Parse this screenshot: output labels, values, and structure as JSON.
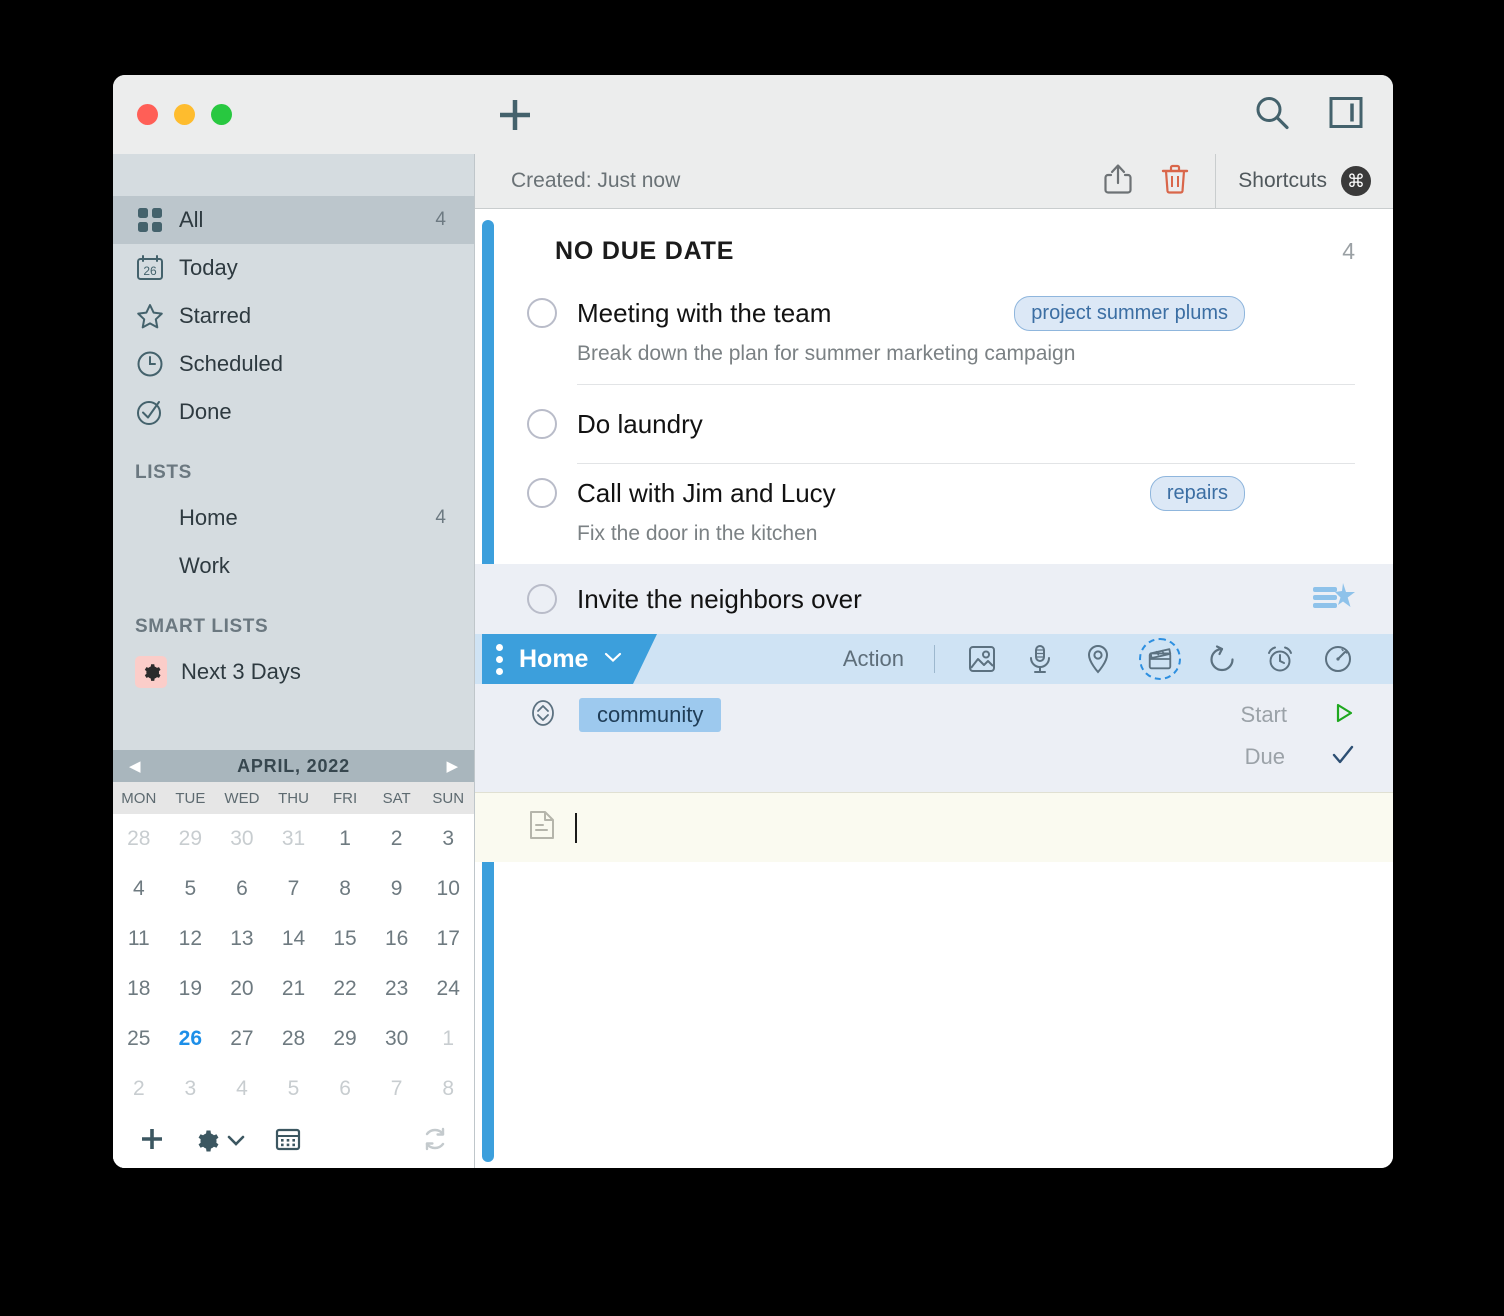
{
  "window": {
    "traffic_lights": [
      "close",
      "minimize",
      "maximize"
    ],
    "add_button_label": "+",
    "search_icon": "search-icon",
    "panel_icon": "sidebar-toggle-icon"
  },
  "sidebar": {
    "smart_items": [
      {
        "label": "All",
        "count": "4",
        "icon": "grid-icon",
        "active": true
      },
      {
        "label": "Today",
        "count": "",
        "icon": "calendar-26-icon",
        "active": false
      },
      {
        "label": "Starred",
        "count": "",
        "icon": "star-icon",
        "active": false
      },
      {
        "label": "Scheduled",
        "count": "",
        "icon": "clock-icon",
        "active": false
      },
      {
        "label": "Done",
        "count": "",
        "icon": "check-circle-icon",
        "active": false
      }
    ],
    "lists_header": "LISTS",
    "lists": [
      {
        "label": "Home",
        "count": "4",
        "color": "#3f9fdb"
      },
      {
        "label": "Work",
        "count": "",
        "color": "#3da93d"
      }
    ],
    "smart_lists_header": "SMART LISTS",
    "smart_lists": [
      {
        "label": "Next 3 Days",
        "icon": "gear-icon",
        "badge_color": "#fbcdc9"
      }
    ]
  },
  "calendar": {
    "title": "APRIL, 2022",
    "prev_label": "◀",
    "next_label": "▶",
    "day_headers": [
      "MON",
      "TUE",
      "WED",
      "THU",
      "FRI",
      "SAT",
      "SUN"
    ],
    "weeks": [
      [
        {
          "d": "28",
          "s": "muted"
        },
        {
          "d": "29",
          "s": "muted"
        },
        {
          "d": "30",
          "s": "muted"
        },
        {
          "d": "31",
          "s": "muted"
        },
        {
          "d": "1",
          "s": ""
        },
        {
          "d": "2",
          "s": ""
        },
        {
          "d": "3",
          "s": ""
        }
      ],
      [
        {
          "d": "4",
          "s": ""
        },
        {
          "d": "5",
          "s": ""
        },
        {
          "d": "6",
          "s": ""
        },
        {
          "d": "7",
          "s": ""
        },
        {
          "d": "8",
          "s": ""
        },
        {
          "d": "9",
          "s": ""
        },
        {
          "d": "10",
          "s": ""
        }
      ],
      [
        {
          "d": "11",
          "s": ""
        },
        {
          "d": "12",
          "s": ""
        },
        {
          "d": "13",
          "s": ""
        },
        {
          "d": "14",
          "s": ""
        },
        {
          "d": "15",
          "s": ""
        },
        {
          "d": "16",
          "s": ""
        },
        {
          "d": "17",
          "s": ""
        }
      ],
      [
        {
          "d": "18",
          "s": ""
        },
        {
          "d": "19",
          "s": ""
        },
        {
          "d": "20",
          "s": ""
        },
        {
          "d": "21",
          "s": ""
        },
        {
          "d": "22",
          "s": ""
        },
        {
          "d": "23",
          "s": ""
        },
        {
          "d": "24",
          "s": ""
        }
      ],
      [
        {
          "d": "25",
          "s": ""
        },
        {
          "d": "26",
          "s": "today"
        },
        {
          "d": "27",
          "s": ""
        },
        {
          "d": "28",
          "s": ""
        },
        {
          "d": "29",
          "s": ""
        },
        {
          "d": "30",
          "s": ""
        },
        {
          "d": "1",
          "s": "muted"
        }
      ],
      [
        {
          "d": "2",
          "s": "muted"
        },
        {
          "d": "3",
          "s": "muted"
        },
        {
          "d": "4",
          "s": "muted"
        },
        {
          "d": "5",
          "s": "muted"
        },
        {
          "d": "6",
          "s": "muted"
        },
        {
          "d": "7",
          "s": "muted"
        },
        {
          "d": "8",
          "s": "muted"
        }
      ]
    ],
    "footer_icons": [
      "plus-icon",
      "gear-icon",
      "chevron-down-icon",
      "calendar-icon",
      "sync-icon"
    ]
  },
  "main_toolbar": {
    "created_text": "Created: Just now",
    "share_icon": "share-icon",
    "trash_icon": "trash-icon",
    "shortcuts_label": "Shortcuts",
    "command_symbol": "⌘"
  },
  "section": {
    "title": "NO DUE DATE",
    "count": "4"
  },
  "tasks": [
    {
      "title": "Meeting with the team",
      "note": "Break down the plan for summer marketing campaign",
      "tag": "project summer plums",
      "selected": false,
      "completed": false
    },
    {
      "title": "Do laundry",
      "note": "",
      "tag": "",
      "selected": false,
      "completed": false
    },
    {
      "title": "Call with Jim and Lucy",
      "note": "Fix the door in the kitchen",
      "tag": "repairs",
      "selected": false,
      "completed": false
    },
    {
      "title": "Invite the neighbors over",
      "note": "",
      "tag": "",
      "selected": true,
      "completed": false,
      "row_icon": "list-star-icon"
    }
  ],
  "editor": {
    "list_name": "Home",
    "list_chevron": "chevron-down-icon",
    "action_label": "Action",
    "icons": [
      {
        "name": "image-icon",
        "selected": false
      },
      {
        "name": "microphone-icon",
        "selected": false
      },
      {
        "name": "location-pin-icon",
        "selected": false
      },
      {
        "name": "clapperboard-icon",
        "selected": true
      },
      {
        "name": "repeat-icon",
        "selected": false
      },
      {
        "name": "alarm-clock-icon",
        "selected": false
      },
      {
        "name": "timer-icon",
        "selected": false
      }
    ],
    "priority_icon": "priority-chevrons-icon",
    "tag": "community",
    "start_label": "Start",
    "start_icon": "play-triangle-icon",
    "due_label": "Due",
    "due_icon": "checkmark-icon",
    "note_icon": "note-document-icon",
    "note_value": ""
  },
  "colors": {
    "accent_blue": "#3c9fdc",
    "today_blue": "#1d8fe8",
    "sidebar_bg": "#d5dce0",
    "selected_row": "#eceff5",
    "note_bg": "#fafaf0",
    "trash_red": "#d9664a",
    "green": "#3da93d"
  }
}
